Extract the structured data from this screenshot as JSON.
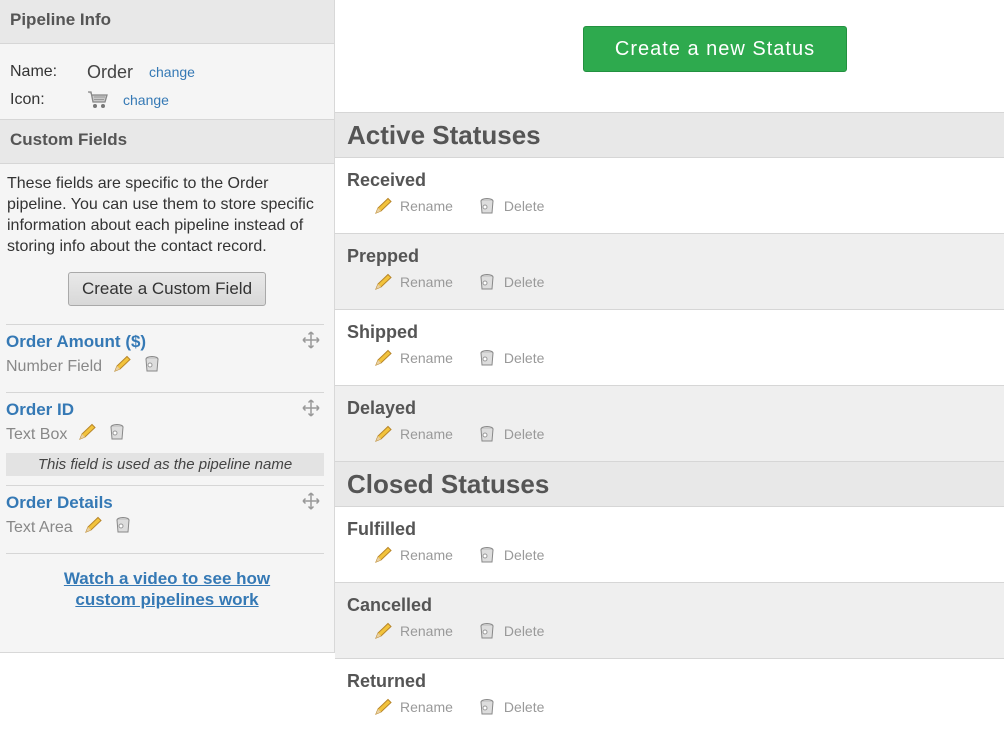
{
  "sidebar": {
    "pipeline_info_title": "Pipeline Info",
    "name_label": "Name:",
    "name_value": "Order",
    "name_change": "change",
    "icon_label": "Icon:",
    "icon_name": "cart-icon",
    "icon_change": "change",
    "custom_fields_title": "Custom Fields",
    "description": "These fields are specific to the Order pipeline. You can use them to store specific information about each pipeline instead of storing info about the contact record.",
    "create_field_button": "Create a Custom Field",
    "fields": [
      {
        "name": "Order Amount ($)",
        "type": "Number Field"
      },
      {
        "name": "Order ID",
        "type": "Text Box",
        "note": "This field is used as the pipeline name"
      },
      {
        "name": "Order Details",
        "type": "Text Area"
      }
    ],
    "video_link": "Watch a video to see how custom pipelines work"
  },
  "main": {
    "create_status_button": "Create a new Status",
    "active_title": "Active Statuses",
    "closed_title": "Closed Statuses",
    "rename_label": "Rename",
    "delete_label": "Delete",
    "active_statuses": [
      "Received",
      "Prepped",
      "Shipped",
      "Delayed"
    ],
    "closed_statuses": [
      "Fulfilled",
      "Cancelled",
      "Returned"
    ]
  },
  "colors": {
    "accent_green": "#2eaa4e",
    "link_blue": "#3579b5"
  }
}
